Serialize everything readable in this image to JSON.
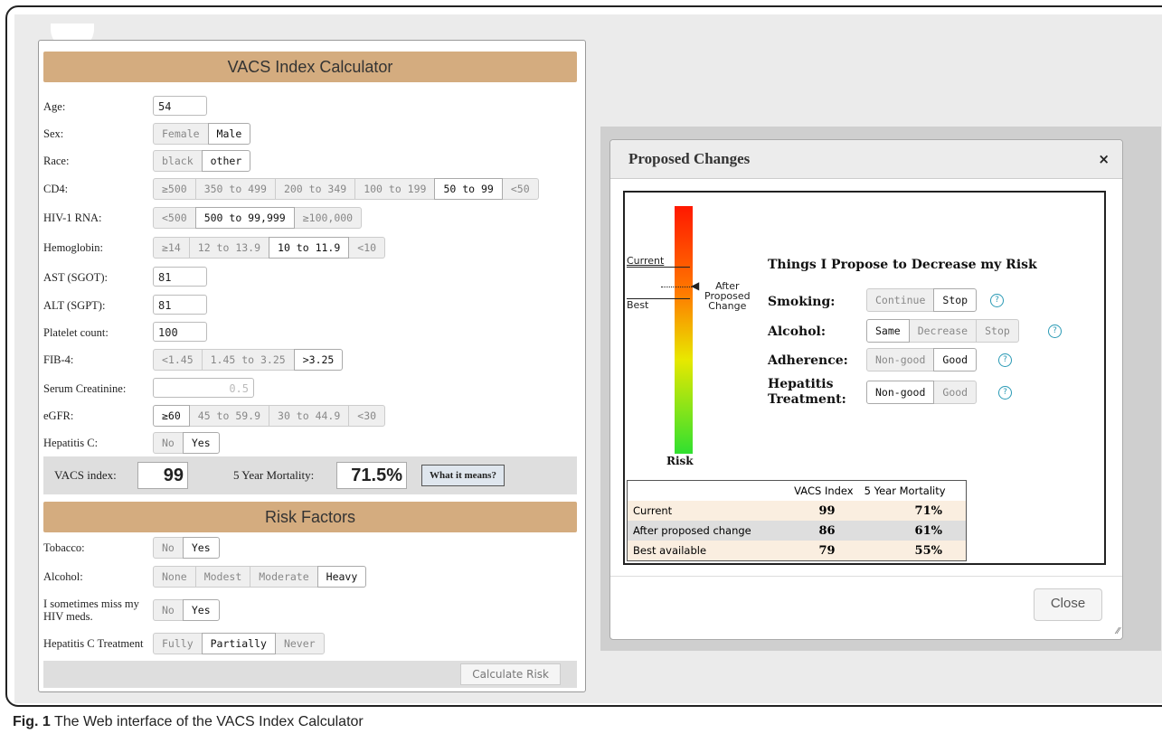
{
  "calculator": {
    "title": "VACS Index Calculator",
    "age": {
      "label": "Age:",
      "value": "54"
    },
    "sex": {
      "label": "Sex:",
      "options": [
        "Female",
        "Male"
      ],
      "selected": "Male"
    },
    "race": {
      "label": "Race:",
      "options": [
        "black",
        "other"
      ],
      "selected": "other"
    },
    "cd4": {
      "label": "CD4:",
      "options": [
        "≥500",
        "350 to 499",
        "200 to 349",
        "100 to 199",
        "50 to 99",
        "<50"
      ],
      "selected": "50 to 99"
    },
    "hiv_rna": {
      "label": "HIV-1 RNA:",
      "options": [
        "<500",
        "500 to 99,999",
        "≥100,000"
      ],
      "selected": "500 to 99,999"
    },
    "hemoglobin": {
      "label": "Hemoglobin:",
      "options": [
        "≥14",
        "12 to 13.9",
        "10 to 11.9",
        "<10"
      ],
      "selected": "10 to 11.9"
    },
    "ast": {
      "label": "AST (SGOT):",
      "value": "81"
    },
    "alt": {
      "label": "ALT (SGPT):",
      "value": "81"
    },
    "platelet": {
      "label": "Platelet count:",
      "value": "100"
    },
    "fib4": {
      "label": "FIB-4:",
      "options": [
        "<1.45",
        "1.45 to 3.25",
        ">3.25"
      ],
      "selected": ">3.25"
    },
    "creatinine": {
      "label": "Serum Creatinine:",
      "placeholder": "0.5"
    },
    "egfr": {
      "label": "eGFR:",
      "options": [
        "≥60",
        "45 to 59.9",
        "30 to 44.9",
        "<30"
      ],
      "selected": "≥60"
    },
    "hepc": {
      "label": "Hepatitis C:",
      "options": [
        "No",
        "Yes"
      ],
      "selected": "Yes"
    },
    "results": {
      "vacs_label": "VACS index:",
      "vacs_value": "99",
      "mortality_label": "5 Year Mortality:",
      "mortality_value": "71.5%",
      "what_button": "What it means?"
    },
    "risk_title": "Risk Factors",
    "tobacco": {
      "label": "Tobacco:",
      "options": [
        "No",
        "Yes"
      ],
      "selected": "Yes"
    },
    "alcohol": {
      "label": "Alcohol:",
      "options": [
        "None",
        "Modest",
        "Moderate",
        "Heavy"
      ],
      "selected": "Heavy"
    },
    "miss_meds": {
      "label": "I sometimes miss my HIV meds.",
      "options": [
        "No",
        "Yes"
      ],
      "selected": "Yes"
    },
    "hepc_treat": {
      "label": "Hepatitis C Treatment",
      "options": [
        "Fully",
        "Partially",
        "Never"
      ],
      "selected": "Partially"
    },
    "calculate_button": "Calculate Risk"
  },
  "modal": {
    "title": "Proposed Changes",
    "close_x": "×",
    "risk_label": "Risk",
    "marker_current": "Current",
    "marker_best": "Best",
    "marker_after": "After\nProposed\nChange",
    "heading": "Things I Propose to Decrease my Risk",
    "smoking": {
      "label": "Smoking:",
      "options": [
        "Continue",
        "Stop"
      ],
      "selected": "Stop"
    },
    "alcohol": {
      "label": "Alcohol:",
      "options": [
        "Same",
        "Decrease",
        "Stop"
      ],
      "selected": "Same"
    },
    "adherence": {
      "label": "Adherence:",
      "options": [
        "Non-good",
        "Good"
      ],
      "selected": "Good"
    },
    "hepatitis": {
      "label": "Hepatitis\nTreatment:",
      "options": [
        "Non-good",
        "Good"
      ],
      "selected": "Non-good"
    },
    "help_glyph": "?",
    "table": {
      "headers": [
        "",
        "VACS Index",
        "5 Year Mortality"
      ],
      "rows": [
        {
          "label": "Current",
          "vacs": "99",
          "mortality": "71%"
        },
        {
          "label": "After proposed change",
          "vacs": "86",
          "mortality": "61%"
        },
        {
          "label": "Best available",
          "vacs": "79",
          "mortality": "55%"
        }
      ]
    },
    "close_button": "Close"
  },
  "caption": {
    "prefix": "Fig. 1",
    "text": " The Web interface of the VACS Index Calculator"
  },
  "colors": {
    "header_tan": "#d4ac7f",
    "help_blue": "#2a9ab5",
    "row_beige": "#faeee0",
    "row_grey": "#dedede"
  }
}
